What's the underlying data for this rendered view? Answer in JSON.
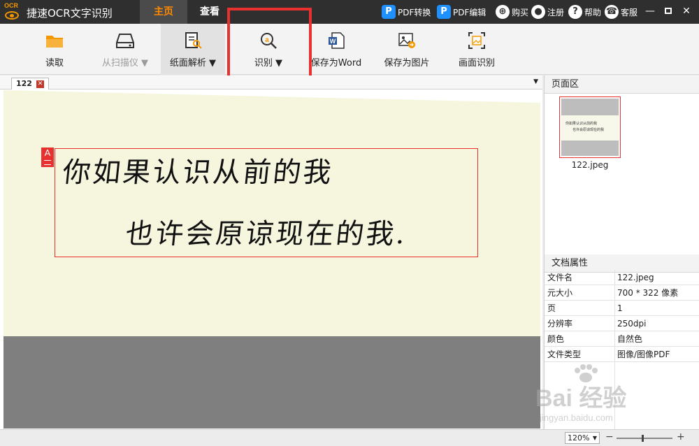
{
  "titlebar": {
    "logo_text": "OCR",
    "app_title": "捷速OCR文字识别",
    "tabs": [
      {
        "label": "主页",
        "active": true
      },
      {
        "label": "查看",
        "active": false
      }
    ],
    "links": {
      "pdf_convert": "PDF转换",
      "pdf_edit": "PDF编辑",
      "buy": "购买",
      "register": "注册",
      "help": "帮助",
      "service": "客服"
    },
    "accent": "#ff8a00"
  },
  "ribbon": {
    "read": "读取",
    "scanner": "从扫描仪 ▼",
    "parse": "纸面解析 ▼",
    "recognize": "识别 ▼",
    "save_word": "保存为Word",
    "save_image": "保存为图片",
    "screen_recognize": "画面识别"
  },
  "document": {
    "tab_name": "122",
    "dropdown_arrow": "▼",
    "region_tag": "A",
    "handwriting_line1": "你如果认识从前的我",
    "handwriting_line2": "也许会原谅现在的我."
  },
  "right_panel": {
    "pages_header": "页面区",
    "thumb_text_1": "你如果认识从前的我",
    "thumb_text_2": "也许会原谅现在的我",
    "thumb_label": "122.jpeg",
    "props_header": "文档属性",
    "props": [
      {
        "k": "文件名",
        "v": "122.jpeg"
      },
      {
        "k": "元大小",
        "v": "700 * 322 像素"
      },
      {
        "k": "页",
        "v": "1"
      },
      {
        "k": "分辨率",
        "v": "250dpi"
      },
      {
        "k": "颜色",
        "v": "自然色"
      },
      {
        "k": "文件类型",
        "v": "图像/图像PDF"
      }
    ]
  },
  "watermark": {
    "main": "Bai 经验",
    "sub": "jingyan.baidu.com"
  },
  "statusbar": {
    "zoom": "120%",
    "zoom_dropdown": "▼",
    "zoom_level_fraction": 0.45,
    "minus": "−",
    "plus": "+"
  }
}
